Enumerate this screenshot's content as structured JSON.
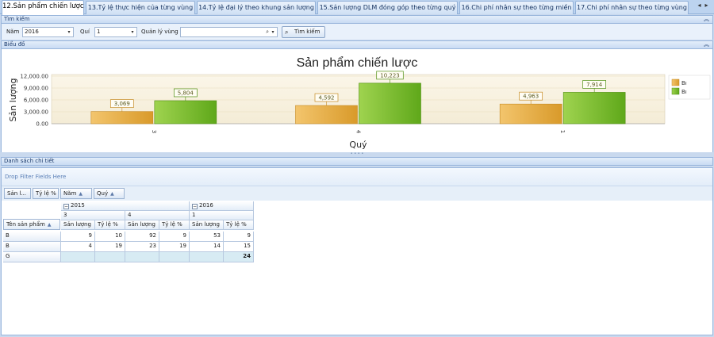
{
  "tabs": [
    {
      "label": "12.Sản phẩm chiến lược",
      "active": true
    },
    {
      "label": "13.Tỷ lệ thực hiện của từng vùng"
    },
    {
      "label": "14.Tỷ lệ đại lý theo khung sản lượng"
    },
    {
      "label": "15.Sản lượng DLM đóng góp theo từng quý"
    },
    {
      "label": "16.Chi phí nhân sự theo từng miền"
    },
    {
      "label": "17.Chi phí nhân sự theo từng vùng"
    }
  ],
  "tab_nav": {
    "prev": "◂",
    "next": "▸"
  },
  "search": {
    "header": "Tìm kiếm",
    "year_label": "Năm",
    "year_value": "2016",
    "quarter_label": "Quí",
    "quarter_value": "1",
    "region_label": "Quản lý vùng",
    "region_value": "",
    "button_label": "Tìm kiếm"
  },
  "chart_section": {
    "header": "Biểu đồ"
  },
  "chart_data": {
    "type": "bar",
    "title": "Sản phẩm chiến lược",
    "xlabel": "Quý",
    "ylabel": "Sản lượng",
    "categories": [
      "3",
      "4",
      "1"
    ],
    "series": [
      {
        "name": "Bı",
        "color": "#e3a83a",
        "values": [
          3069,
          4592,
          4963
        ]
      },
      {
        "name": "Bı",
        "color": "#7cbd2c",
        "values": [
          5804,
          10223,
          7914
        ]
      }
    ],
    "value_labels": [
      [
        "3,069",
        "4,592",
        "4,963"
      ],
      [
        "5,804",
        "10,223",
        "7,914"
      ]
    ],
    "yticks": [
      "0.00",
      "3,000.00",
      "6,000.00",
      "9,000.00",
      "12,000.00"
    ],
    "ylim": [
      0,
      12000
    ],
    "grid": true,
    "legend": "right"
  },
  "details": {
    "header": "Danh sách chi tiết",
    "drop_hint": "Drop Filter Fields Here",
    "filter_fields": [
      "Sản l...",
      "Tỷ lệ %"
    ],
    "column_fields": [
      "Năm",
      "Quý"
    ],
    "row_field": "Tên sản phẩm",
    "years": [
      "2015",
      "2016"
    ],
    "quarters": [
      "3",
      "4",
      "1"
    ],
    "measure_headers": [
      "Sản lượng",
      "Tỷ lệ %"
    ],
    "rows": [
      {
        "name": "B",
        "values": [
          "9",
          "10",
          "92",
          "9",
          "53",
          "9"
        ]
      },
      {
        "name": "B",
        "values": [
          "4",
          "19",
          "23",
          "19",
          "14",
          "15"
        ]
      },
      {
        "name": "G",
        "values": [
          "",
          "",
          "",
          "",
          "",
          "24"
        ]
      }
    ]
  }
}
